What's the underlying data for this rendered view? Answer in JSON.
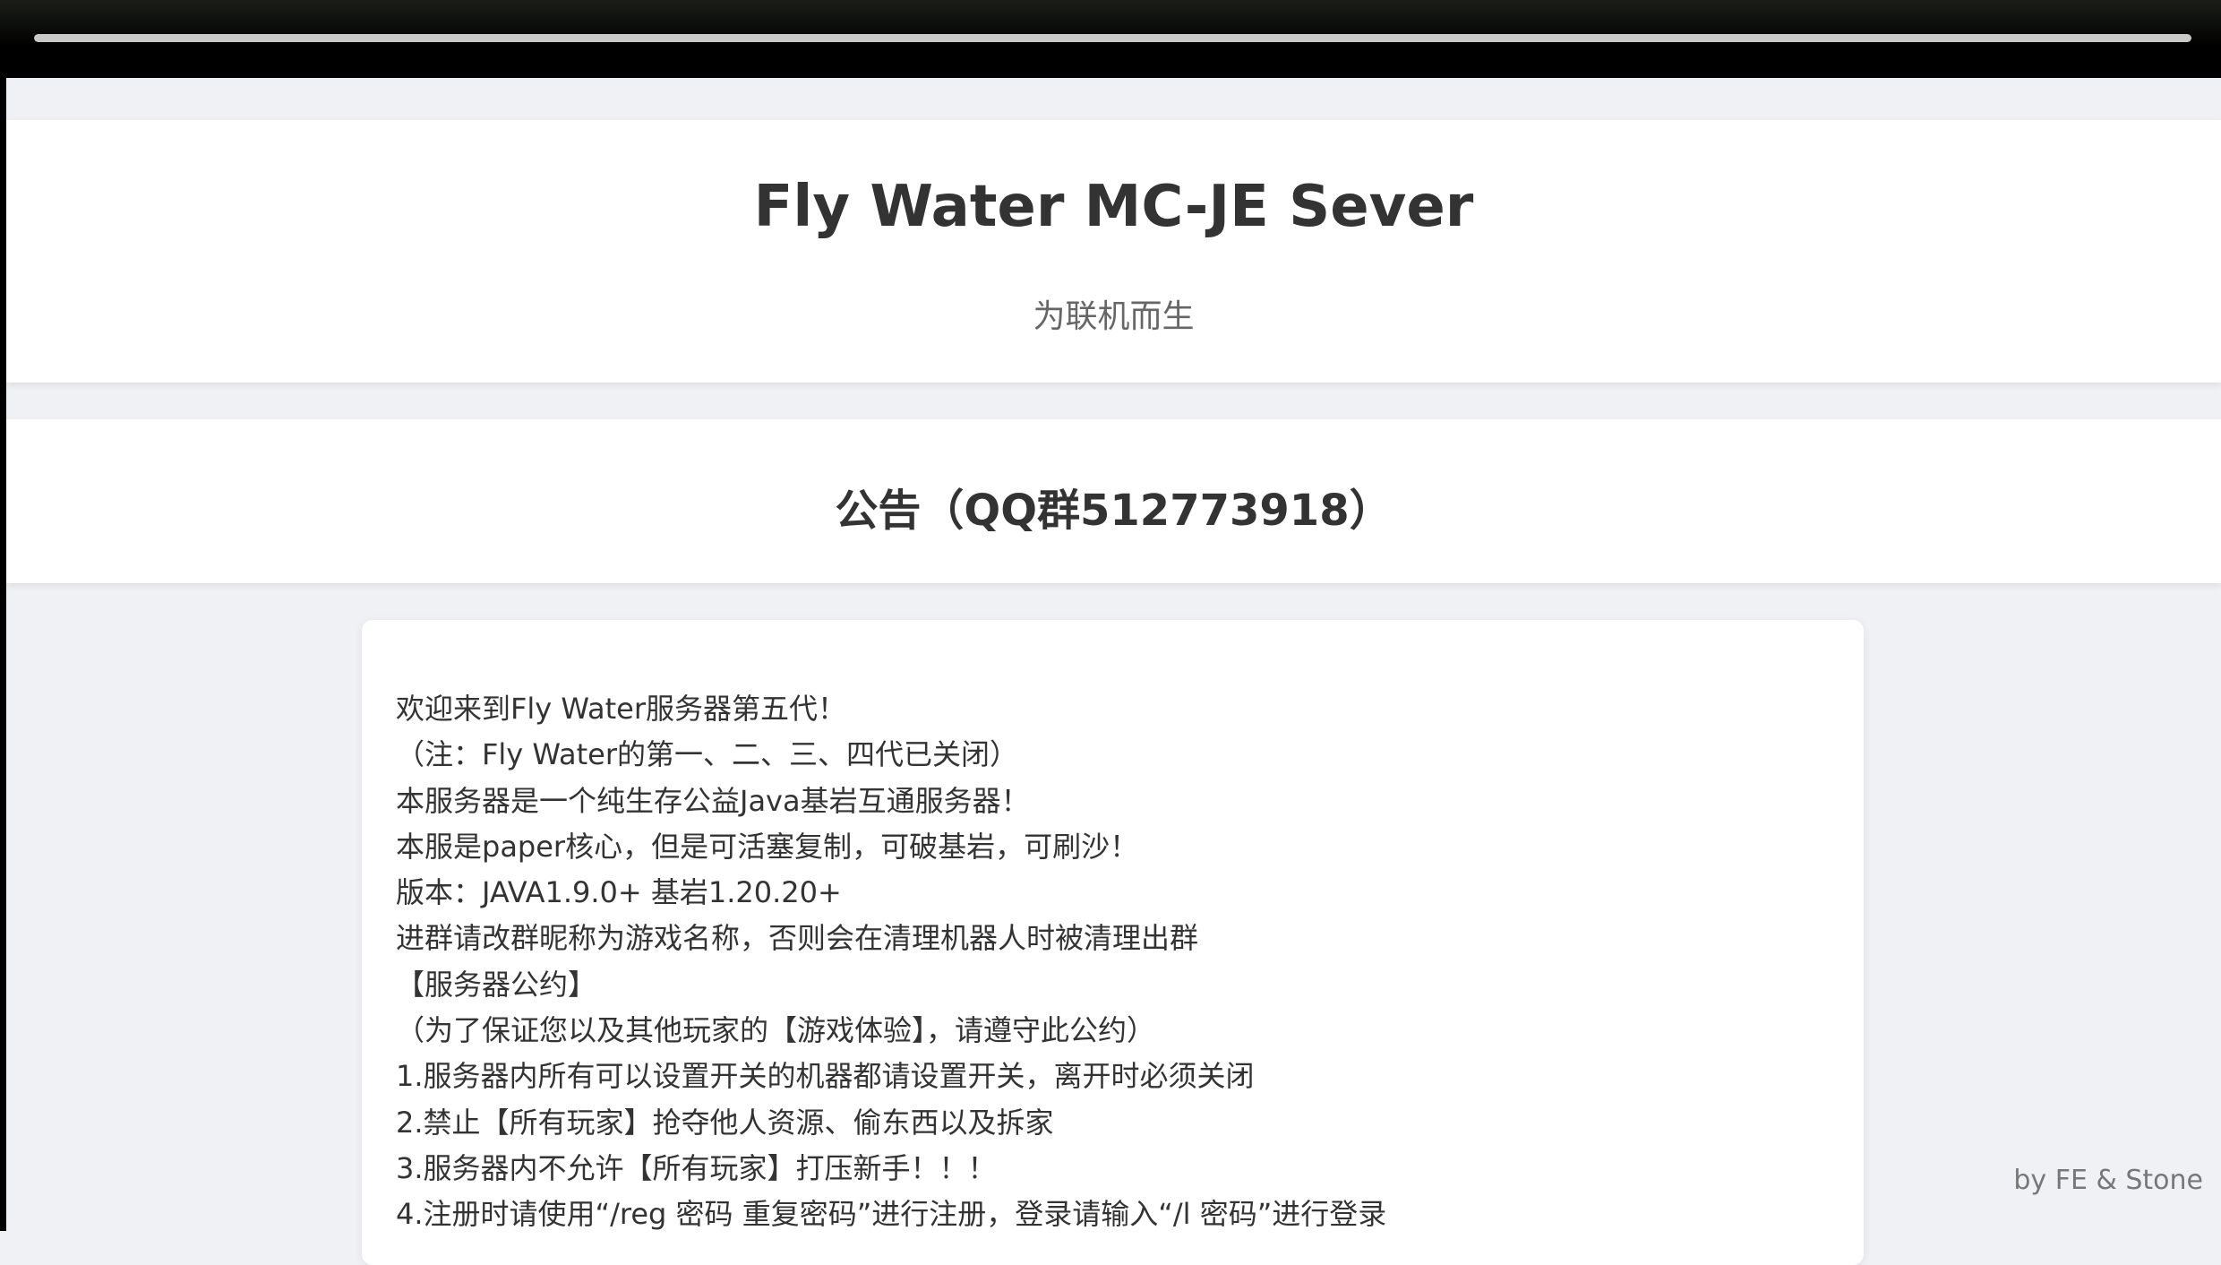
{
  "browser": {
    "load_progress": 1.0
  },
  "header": {
    "title": "Fly Water MC-JE Sever",
    "subtitle": "为联机而生"
  },
  "notice": {
    "title": "公告（QQ群512773918）"
  },
  "content": {
    "lines": [
      "欢迎来到Fly Water服务器第五代！",
      "（注：Fly Water的第一、二、三、四代已关闭）",
      "本服务器是一个纯生存公益Java基岩互通服务器！",
      "本服是paper核心，但是可活塞复制，可破基岩，可刷沙！",
      "版本：JAVA1.9.0+ 基岩1.20.20+",
      "进群请改群昵称为游戏名称，否则会在清理机器人时被清理出群",
      "【服务器公约】",
      "（为了保证您以及其他玩家的【游戏体验】，请遵守此公约）",
      "1.服务器内所有可以设置开关的机器都请设置开关，离开时必须关闭",
      "2.禁止【所有玩家】抢夺他人资源、偷东西以及拆家",
      "3.服务器内不允许【所有玩家】打压新手！！！",
      "4.注册时请使用“/reg 密码 重复密码”进行注册，登录请输入“/l 密码”进行登录"
    ]
  },
  "footer": {
    "credit": "by FE & Stone"
  },
  "colors": {
    "page_background": "#f0f1f4",
    "card_background": "#ffffff",
    "text_primary": "#333333",
    "text_secondary": "#666666"
  }
}
